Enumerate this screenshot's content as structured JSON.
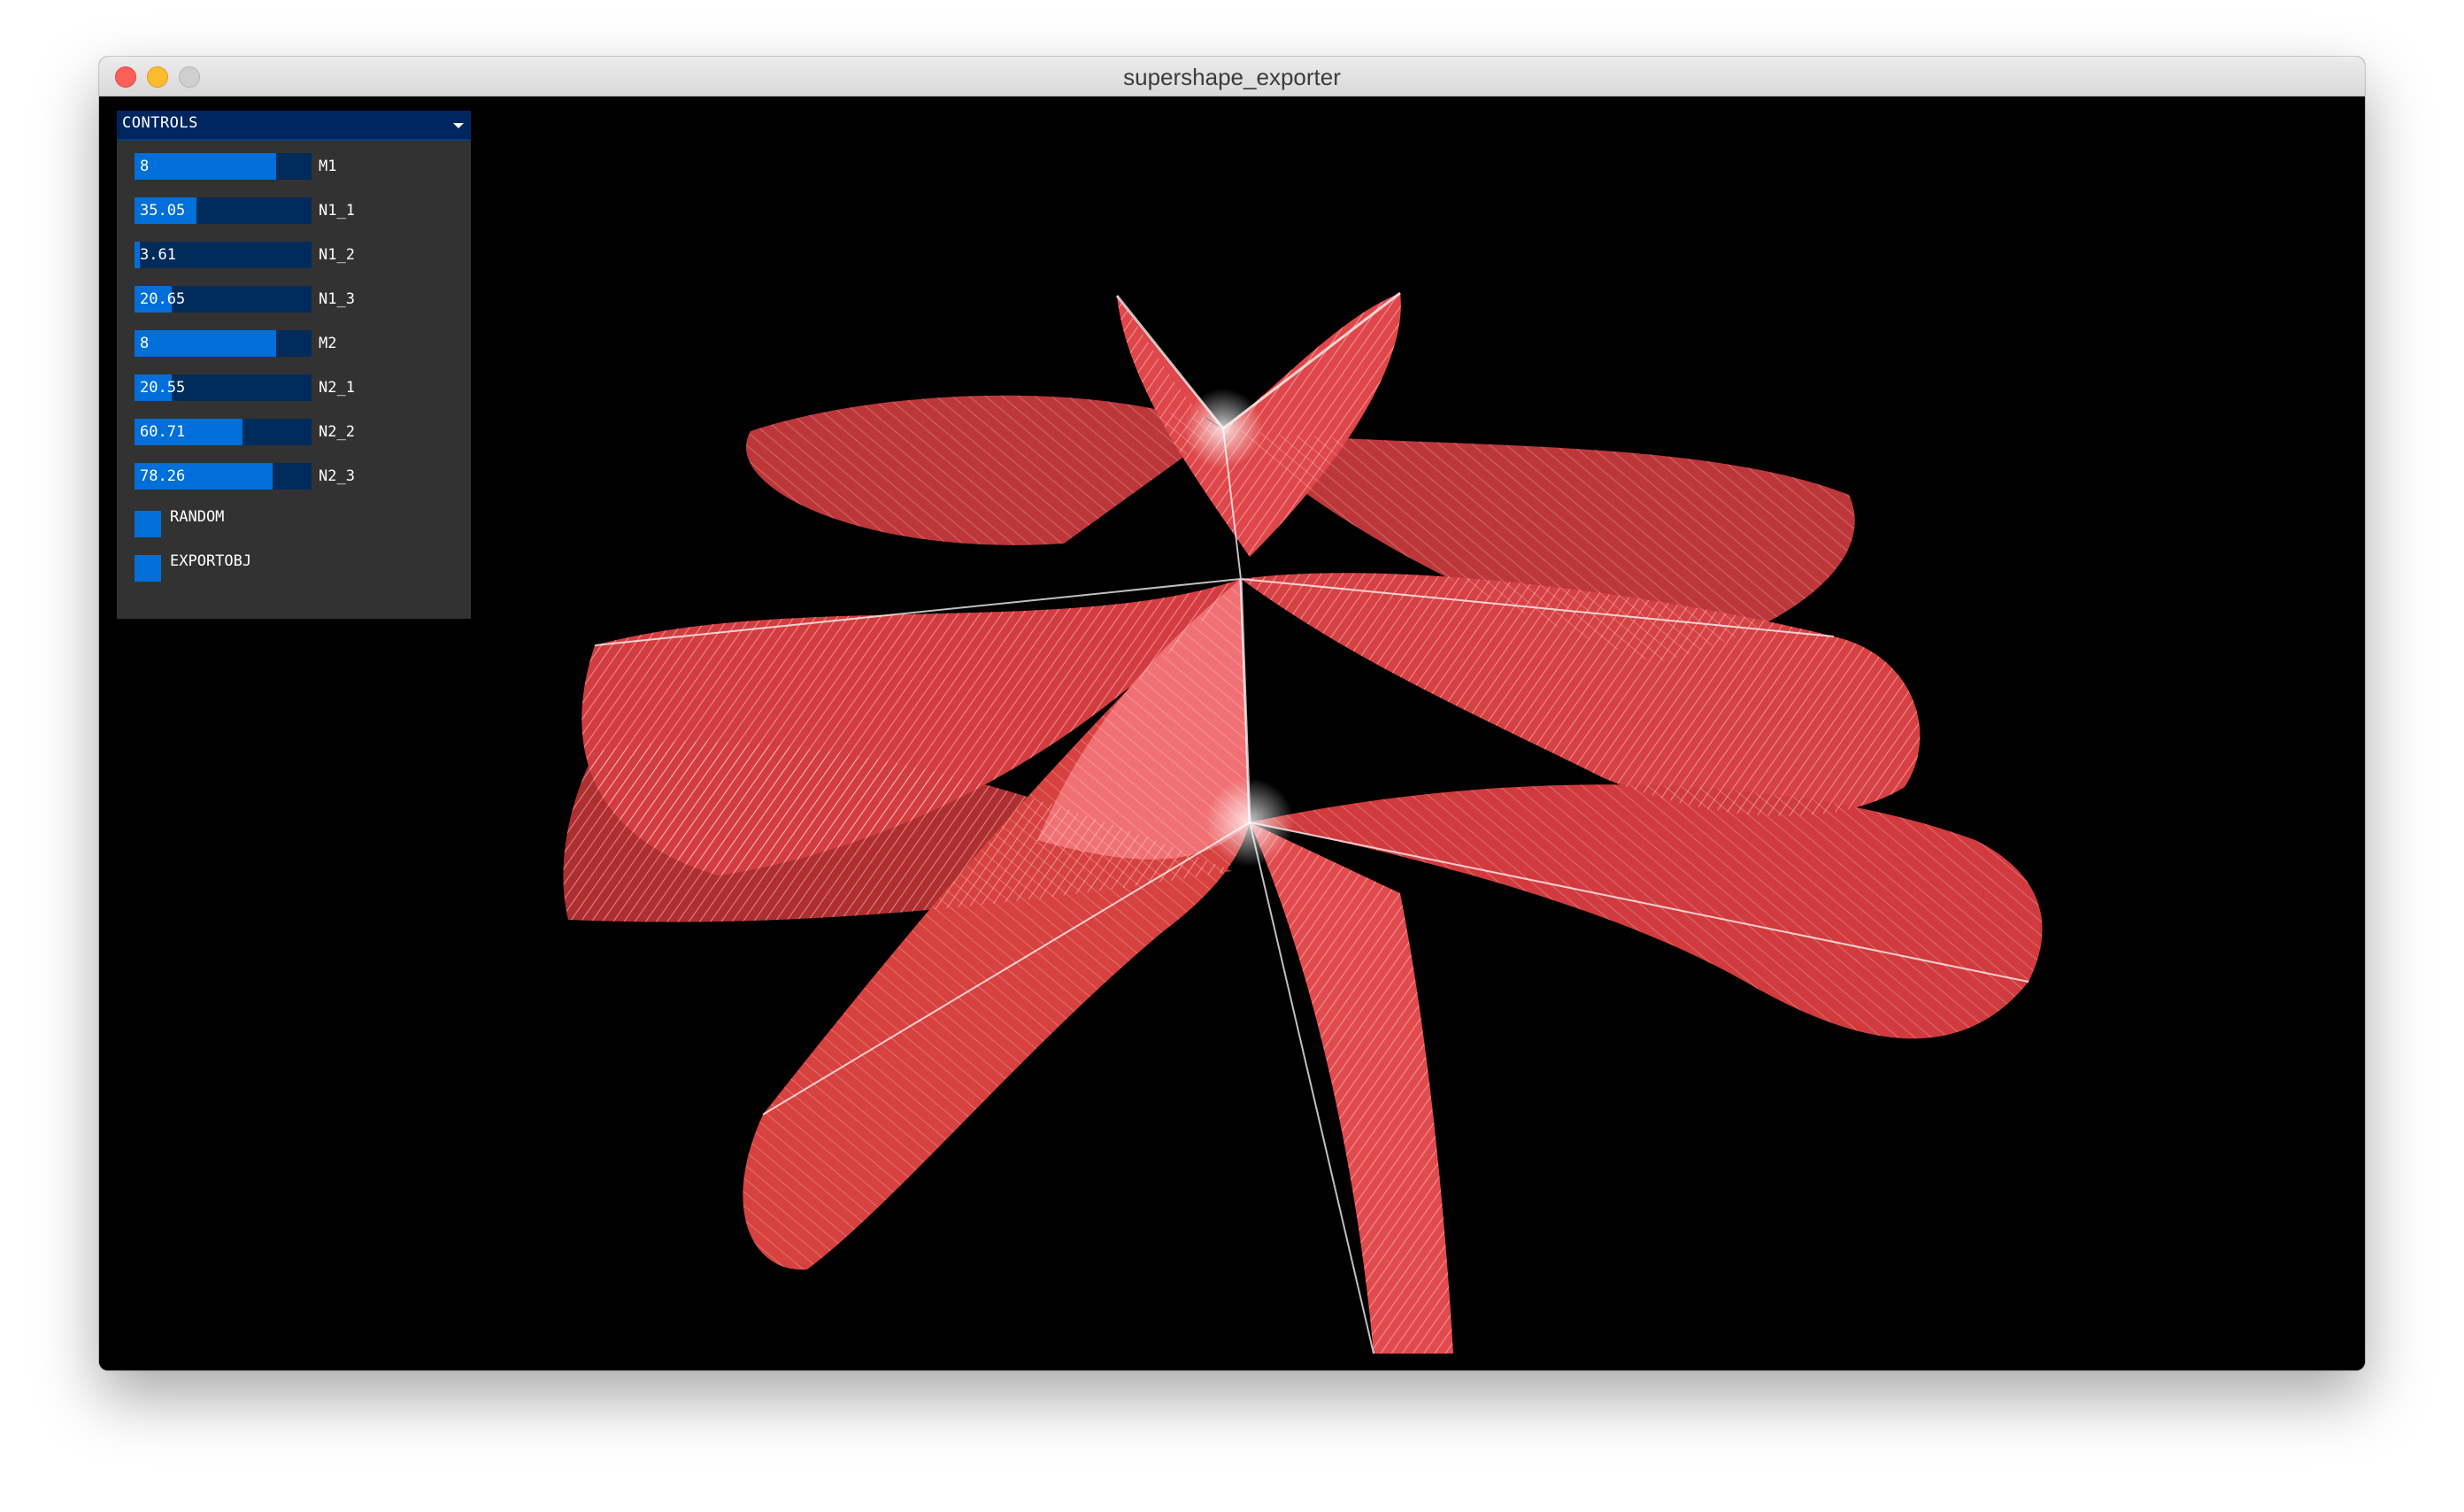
{
  "window": {
    "title": "supershape_exporter"
  },
  "controls": {
    "title": "CONTROLS",
    "sliders": [
      {
        "label": "M1",
        "value": "8",
        "fill": 0.8
      },
      {
        "label": "N1_1",
        "value": "35.05",
        "fill": 0.35
      },
      {
        "label": "N1_2",
        "value": "3.61",
        "fill": 0.03
      },
      {
        "label": "N1_3",
        "value": "20.65",
        "fill": 0.21
      },
      {
        "label": "M2",
        "value": "8",
        "fill": 0.8
      },
      {
        "label": "N2_1",
        "value": "20.55",
        "fill": 0.21
      },
      {
        "label": "N2_2",
        "value": "60.71",
        "fill": 0.61
      },
      {
        "label": "N2_3",
        "value": "78.26",
        "fill": 0.78
      }
    ],
    "toggles": [
      {
        "label": "RANDOM"
      },
      {
        "label": "EXPORTOBJ"
      }
    ]
  },
  "colors": {
    "panel_bg": "#323232",
    "header_bg": "#00265f",
    "slider_track": "#002c5b",
    "slider_fill": "#006fd9",
    "shape_fill": "#e0474a",
    "shape_wire": "#ffd6d6"
  }
}
